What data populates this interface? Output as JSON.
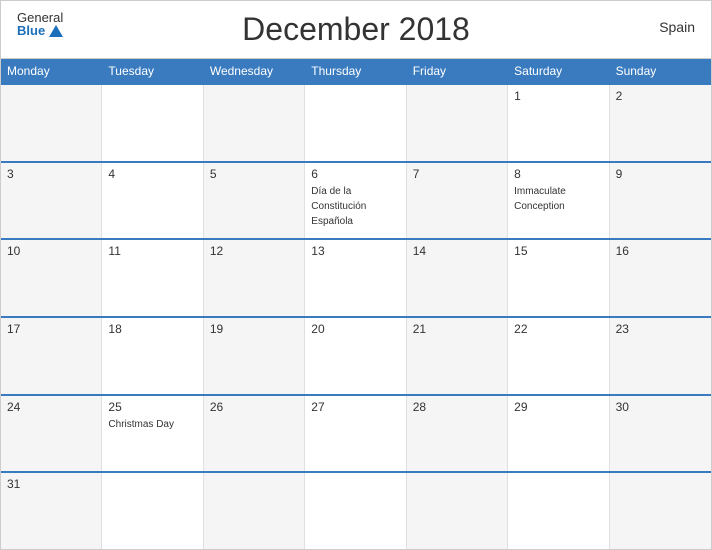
{
  "header": {
    "title": "December 2018",
    "country": "Spain",
    "logo_general": "General",
    "logo_blue": "Blue"
  },
  "day_headers": [
    "Monday",
    "Tuesday",
    "Wednesday",
    "Thursday",
    "Friday",
    "Saturday",
    "Sunday"
  ],
  "weeks": [
    [
      {
        "day": "",
        "event": ""
      },
      {
        "day": "",
        "event": ""
      },
      {
        "day": "",
        "event": ""
      },
      {
        "day": "",
        "event": ""
      },
      {
        "day": "",
        "event": ""
      },
      {
        "day": "1",
        "event": ""
      },
      {
        "day": "2",
        "event": ""
      }
    ],
    [
      {
        "day": "3",
        "event": ""
      },
      {
        "day": "4",
        "event": ""
      },
      {
        "day": "5",
        "event": ""
      },
      {
        "day": "6",
        "event": "Día de la Constitución Española"
      },
      {
        "day": "7",
        "event": ""
      },
      {
        "day": "8",
        "event": "Immaculate Conception"
      },
      {
        "day": "9",
        "event": ""
      }
    ],
    [
      {
        "day": "10",
        "event": ""
      },
      {
        "day": "11",
        "event": ""
      },
      {
        "day": "12",
        "event": ""
      },
      {
        "day": "13",
        "event": ""
      },
      {
        "day": "14",
        "event": ""
      },
      {
        "day": "15",
        "event": ""
      },
      {
        "day": "16",
        "event": ""
      }
    ],
    [
      {
        "day": "17",
        "event": ""
      },
      {
        "day": "18",
        "event": ""
      },
      {
        "day": "19",
        "event": ""
      },
      {
        "day": "20",
        "event": ""
      },
      {
        "day": "21",
        "event": ""
      },
      {
        "day": "22",
        "event": ""
      },
      {
        "day": "23",
        "event": ""
      }
    ],
    [
      {
        "day": "24",
        "event": ""
      },
      {
        "day": "25",
        "event": "Christmas Day"
      },
      {
        "day": "26",
        "event": ""
      },
      {
        "day": "27",
        "event": ""
      },
      {
        "day": "28",
        "event": ""
      },
      {
        "day": "29",
        "event": ""
      },
      {
        "day": "30",
        "event": ""
      }
    ],
    [
      {
        "day": "31",
        "event": ""
      },
      {
        "day": "",
        "event": ""
      },
      {
        "day": "",
        "event": ""
      },
      {
        "day": "",
        "event": ""
      },
      {
        "day": "",
        "event": ""
      },
      {
        "day": "",
        "event": ""
      },
      {
        "day": "",
        "event": ""
      }
    ]
  ]
}
